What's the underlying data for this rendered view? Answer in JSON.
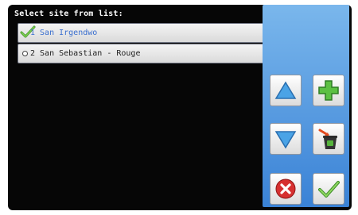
{
  "header": {
    "title": "Select site from list:"
  },
  "sites": [
    {
      "label": "1 San Irgendwo",
      "selected": true
    },
    {
      "label": "2 San Sebastian - Rouge",
      "selected": false
    }
  ],
  "icons": {
    "up": "up-arrow-icon",
    "add": "plus-icon",
    "down": "down-arrow-icon",
    "delete": "trash-icon",
    "cancel": "cancel-icon",
    "confirm": "checkmark-icon",
    "selected": "checkmark-icon",
    "unselected": "radio-icon"
  },
  "colors": {
    "background": "#060606",
    "panel": "#5b9fe3",
    "selected_text": "#3a6fcf",
    "accent_green": "#4fb33a",
    "cancel_red": "#d63030"
  }
}
